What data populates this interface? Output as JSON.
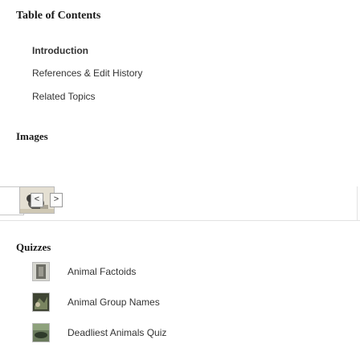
{
  "toc": {
    "title": "Table of Contents",
    "links": [
      {
        "label": "Introduction"
      },
      {
        "label": "References & Edit History"
      },
      {
        "label": "Related Topics"
      }
    ]
  },
  "images": {
    "title": "Images",
    "prev_icon": "chevron-left-icon",
    "next_icon": "chevron-right-icon",
    "prev_label": "<",
    "next_label": ">"
  },
  "quizzes": {
    "title": "Quizzes",
    "items": [
      {
        "label": "Animal Factoids"
      },
      {
        "label": "Animal Group Names"
      },
      {
        "label": "Deadliest Animals Quiz"
      }
    ]
  },
  "colors": {
    "text": "#333333",
    "heading": "#1a1a1a",
    "divider": "#e2e2e2"
  }
}
